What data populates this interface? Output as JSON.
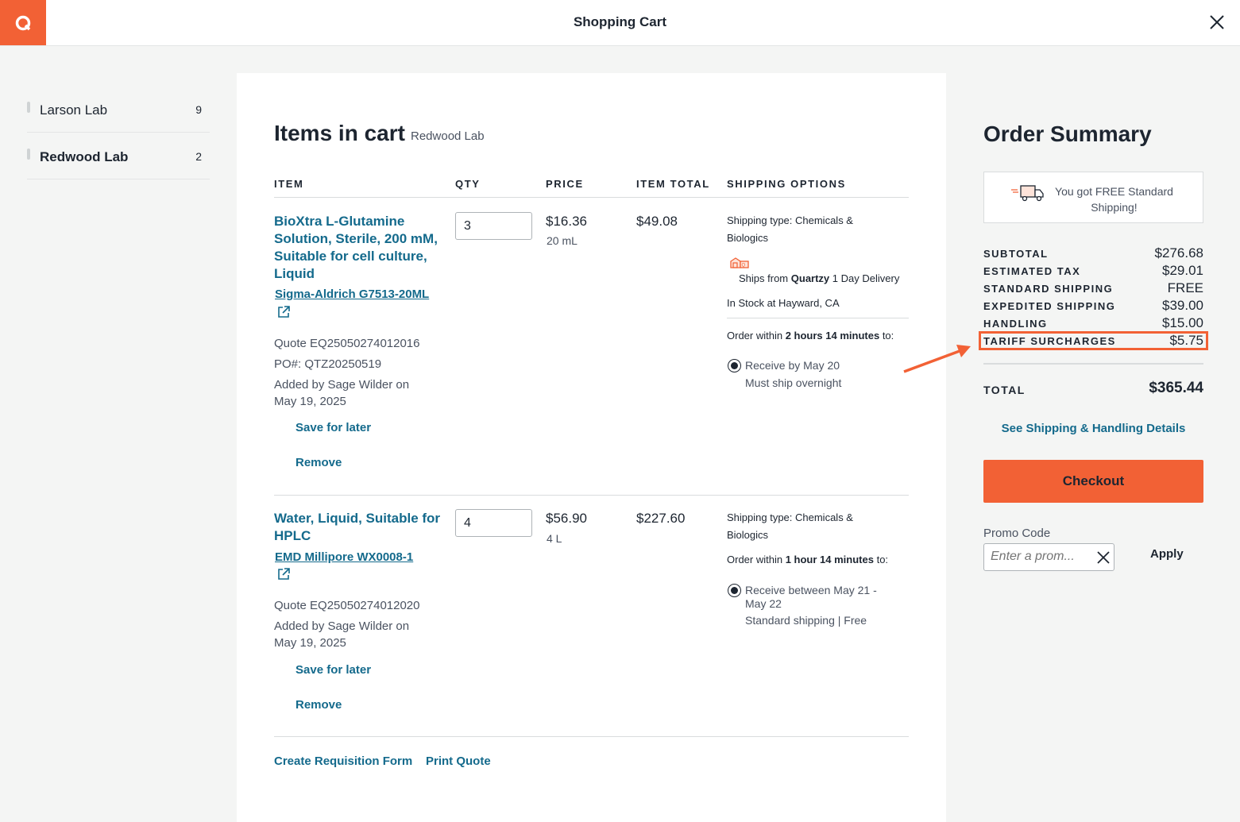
{
  "header": {
    "title": "Shopping Cart",
    "logo_letter": "Q"
  },
  "sidebar": {
    "labs": [
      {
        "name": "Larson Lab",
        "count": "9"
      },
      {
        "name": "Redwood Lab",
        "count": "2"
      }
    ]
  },
  "cart": {
    "heading": "Items in cart",
    "lab_name": "Redwood Lab",
    "columns": [
      "ITEM",
      "QTY",
      "PRICE",
      "ITEM TOTAL",
      "SHIPPING OPTIONS"
    ],
    "items": [
      {
        "name": "BioXtra L-Glutamine Solution, Sterile, 200 mM, Suitable for cell culture, Liquid",
        "catalog": "Sigma-Aldrich G7513-20ML",
        "quote": "Quote EQ25050274012016",
        "po": "PO#: QTZ20250519",
        "added_by": "Added by Sage Wilder on May 19, 2025",
        "qty": "3",
        "price": "$16.36",
        "unit": "20 mL",
        "item_total": "$49.08",
        "shipping_type": "Shipping type: Chemicals & Biologics",
        "ships_from_prefix": "Ships from",
        "ships_from_vendor": "Quartzy",
        "ships_from_suffix": "1 Day Delivery",
        "stock": "In Stock at Hayward, CA",
        "order_within_prefix": "Order within",
        "order_within_time": "2 hours 14 minutes",
        "order_within_suffix": "to:",
        "receive": "Receive by May 20",
        "receive_note": "Must ship overnight",
        "save_label": "Save for later",
        "remove_label": "Remove"
      },
      {
        "name": "Water, Liquid, Suitable for HPLC",
        "catalog": "EMD Millipore WX0008-1",
        "quote": "Quote EQ25050274012020",
        "added_by": "Added by Sage Wilder on May 19, 2025",
        "qty": "4",
        "price": "$56.90",
        "unit": "4 L",
        "item_total": "$227.60",
        "shipping_type": "Shipping type: Chemicals & Biologics",
        "order_within_prefix": "Order within",
        "order_within_time": "1 hour 14 minutes",
        "order_within_suffix": "to:",
        "receive": "Receive between May 21 - May 22",
        "receive_note": "Standard shipping | Free",
        "save_label": "Save for later",
        "remove_label": "Remove"
      }
    ],
    "footer_links": [
      "Create Requisition Form",
      "Print Quote"
    ]
  },
  "summary": {
    "title": "Order Summary",
    "free_shipping": "You got FREE Standard Shipping!",
    "rows": [
      {
        "label": "SUBTOTAL",
        "value": "$276.68"
      },
      {
        "label": "ESTIMATED TAX",
        "value": "$29.01"
      },
      {
        "label": "STANDARD SHIPPING",
        "value": "FREE"
      },
      {
        "label": "EXPEDITED SHIPPING",
        "value": "$39.00"
      },
      {
        "label": "HANDLING",
        "value": "$15.00"
      },
      {
        "label": "TARIFF SURCHARGES",
        "value": "$5.75"
      }
    ],
    "total_label": "TOTAL",
    "total_value": "$365.44",
    "details_link": "See Shipping & Handling Details",
    "checkout_label": "Checkout",
    "promo_label": "Promo Code",
    "promo_placeholder": "Enter a prom...",
    "apply_label": "Apply"
  },
  "colors": {
    "accent": "#f26135",
    "link": "#146a8c",
    "text": "#1d2530"
  }
}
